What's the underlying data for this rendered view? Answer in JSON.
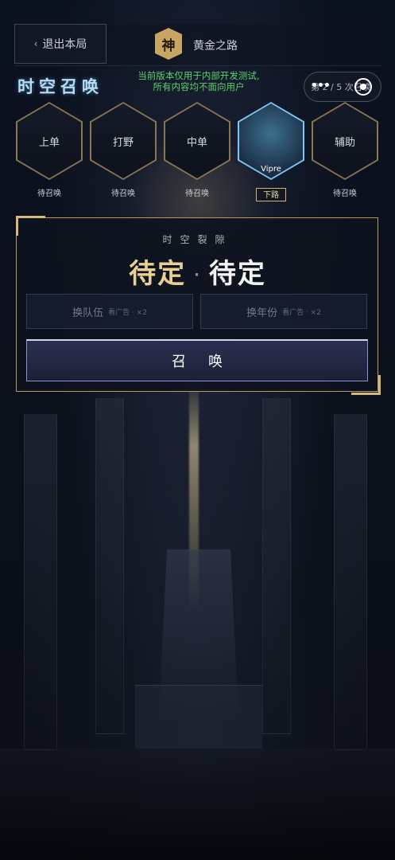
{
  "header": {
    "exit_label": "退出本局",
    "badge_text": "神",
    "rank_name": "黄金之路"
  },
  "page_title": "时空召唤",
  "notice": {
    "line1": "当前版本仅用于内部开发测试,",
    "line2": "所有内容均不面向用户"
  },
  "round": {
    "text": "第 2 / 5 次召唤"
  },
  "slots": [
    {
      "label": "上单",
      "status": "待召唤"
    },
    {
      "label": "打野",
      "status": "待召唤"
    },
    {
      "label": "中单",
      "status": "待召唤"
    },
    {
      "label": "",
      "name": "Vipre",
      "lane_tag": "下路"
    },
    {
      "label": "辅助",
      "status": "待召唤"
    }
  ],
  "panel": {
    "rift_label": "时空裂隙",
    "result_left": "待定",
    "result_dot": "·",
    "result_right": "待定",
    "swap_team": {
      "label": "换队伍",
      "sub": "看广告 · ×2"
    },
    "swap_year": {
      "label": "换年份",
      "sub": "看广告 · ×2"
    },
    "summon_label": "召唤"
  },
  "colors": {
    "accent_gold": "#d6b978",
    "active_cyan": "#7fc7f2",
    "notice_green": "#5fd06a"
  }
}
